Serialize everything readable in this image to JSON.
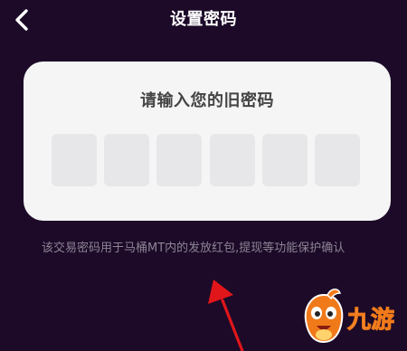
{
  "header": {
    "back_icon": "chevron-left-icon",
    "title": "设置密码"
  },
  "card": {
    "title": "请输入您的旧密码",
    "digit_count": 6
  },
  "hint": "该交易密码用于马桶MT内的发放红包,提现等功能保护确认",
  "watermark": {
    "text": "九游",
    "icon": "mascot-icon"
  },
  "colors": {
    "background": "#1c0a28",
    "card": "#f5f5f6",
    "digit_box": "#e7e7e9",
    "annotation_arrow": "#e0161b",
    "logo_orange": "#f07a1a"
  }
}
